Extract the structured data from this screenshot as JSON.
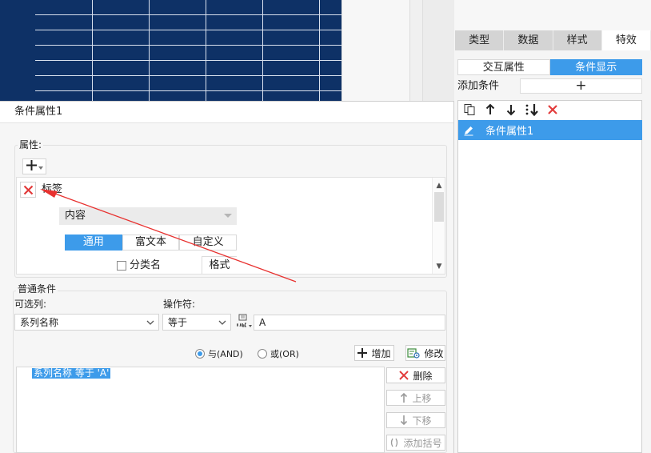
{
  "right_panel": {
    "tabs": [
      "类型",
      "数据",
      "样式",
      "特效"
    ],
    "active_tab_index": 3,
    "subtabs": [
      "交互属性",
      "条件显示"
    ],
    "active_subtab_index": 1,
    "add_condition_label": "添加条件",
    "add_condition_btn": "+",
    "condition_items": [
      "条件属性1"
    ]
  },
  "dialog": {
    "title": "条件属性1",
    "attributes_group": {
      "legend": "属性:",
      "add_btn": "+",
      "attribute_label": "标签",
      "content_select_value": "内容",
      "format_tabs": [
        "通用",
        "富文本",
        "自定义"
      ],
      "active_format_tab": 0,
      "category_name_checkbox": "分类名",
      "category_name_checked": false,
      "format_button": "格式"
    },
    "condition_group": {
      "legend": "普通条件",
      "columns_label": "可选列:",
      "operator_label": "操作符:",
      "column_value": "系列名称",
      "operator_value": "等于",
      "value_input": "A",
      "radio_and": "与(AND)",
      "radio_or": "或(OR)",
      "radio_selected": "and",
      "add_button": "增加",
      "modify_button": "修改",
      "condition_text": "系列名称 等于 'A'",
      "delete_button": "删除",
      "move_up_button": "上移",
      "move_down_button": "下移",
      "add_bracket_button": "添加括号"
    }
  },
  "colors": {
    "accent": "#3d9bea",
    "canvas_navy": "#0e3166",
    "delete_red": "#e23b3b",
    "annotation_red": "#e8312f"
  }
}
